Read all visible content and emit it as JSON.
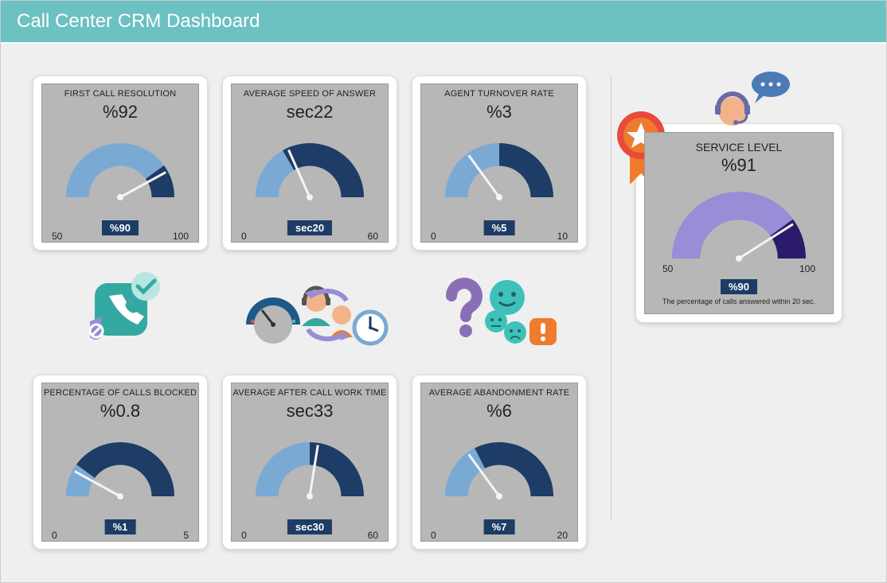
{
  "header": {
    "title": "Call Center CRM Dashboard"
  },
  "colors": {
    "arc_light": "#7aa9d4",
    "arc_dark": "#1d3c66",
    "purple_light": "#9a8cd6",
    "purple_dark": "#2b1a6b",
    "teal": "#34a9a1",
    "teal2": "#3fc1bb",
    "orange": "#ef7b2d",
    "red": "#e84a3c",
    "yellow": "#f6b73c"
  },
  "gauges": [
    {
      "id": "first-call-resolution",
      "title": "FIRST CALL RESOLUTION",
      "value_label": "%92",
      "value": 92,
      "min": 50,
      "min_label": "50",
      "max": 100,
      "max_label": "100",
      "target_label": "%90",
      "target": 90
    },
    {
      "id": "avg-speed-answer",
      "title": "AVERAGE SPEED OF ANSWER",
      "value_label": "sec22",
      "value": 22,
      "min": 0,
      "min_label": "0",
      "max": 60,
      "max_label": "60",
      "target_label": "sec20",
      "target": 20
    },
    {
      "id": "agent-turnover",
      "title": "AGENT TURNOVER RATE",
      "value_label": "%3",
      "value": 3,
      "min": 0,
      "min_label": "0",
      "max": 10,
      "max_label": "10",
      "target_label": "%5",
      "target": 5
    },
    {
      "id": "calls-blocked",
      "title": "PERCENTAGE OF CALLS BLOCKED",
      "value_label": "%0.8",
      "value": 0.8,
      "min": 0,
      "min_label": "0",
      "max": 5,
      "max_label": "5",
      "target_label": "%1",
      "target": 1
    },
    {
      "id": "after-call-work",
      "title": "AVERAGE AFTER CALL WORK TIME",
      "value_label": "sec33",
      "value": 33,
      "min": 0,
      "min_label": "0",
      "max": 60,
      "max_label": "60",
      "target_label": "sec30",
      "target": 30
    },
    {
      "id": "abandonment-rate",
      "title": "AVERAGE ABANDONMENT RATE",
      "value_label": "%6",
      "value": 6,
      "min": 0,
      "min_label": "0",
      "max": 20,
      "max_label": "20",
      "target_label": "%7",
      "target": 7
    }
  ],
  "feature": {
    "id": "service-level",
    "title": "SERVICE LEVEL",
    "value_label": "%91",
    "value": 91,
    "min": 50,
    "min_label": "50",
    "max": 100,
    "max_label": "100",
    "target_label": "%90",
    "target": 90,
    "note": "The percentage of calls answered within 20 sec."
  },
  "icons_row": [
    "phone-check-shield-icon",
    "agent-clock-gauge-icon",
    "question-faces-alert-icon"
  ],
  "chart_data": [
    {
      "type": "gauge",
      "title": "FIRST CALL RESOLUTION",
      "value": 92,
      "target": 90,
      "range": [
        50,
        100
      ],
      "unit": "%"
    },
    {
      "type": "gauge",
      "title": "AVERAGE SPEED OF ANSWER",
      "value": 22,
      "target": 20,
      "range": [
        0,
        60
      ],
      "unit": "sec"
    },
    {
      "type": "gauge",
      "title": "AGENT TURNOVER RATE",
      "value": 3,
      "target": 5,
      "range": [
        0,
        10
      ],
      "unit": "%"
    },
    {
      "type": "gauge",
      "title": "PERCENTAGE OF CALLS BLOCKED",
      "value": 0.8,
      "target": 1,
      "range": [
        0,
        5
      ],
      "unit": "%"
    },
    {
      "type": "gauge",
      "title": "AVERAGE AFTER CALL WORK TIME",
      "value": 33,
      "target": 30,
      "range": [
        0,
        60
      ],
      "unit": "sec"
    },
    {
      "type": "gauge",
      "title": "AVERAGE ABANDONMENT RATE",
      "value": 6,
      "target": 7,
      "range": [
        0,
        20
      ],
      "unit": "%"
    },
    {
      "type": "gauge",
      "title": "SERVICE LEVEL",
      "value": 91,
      "target": 90,
      "range": [
        50,
        100
      ],
      "unit": "%"
    }
  ]
}
